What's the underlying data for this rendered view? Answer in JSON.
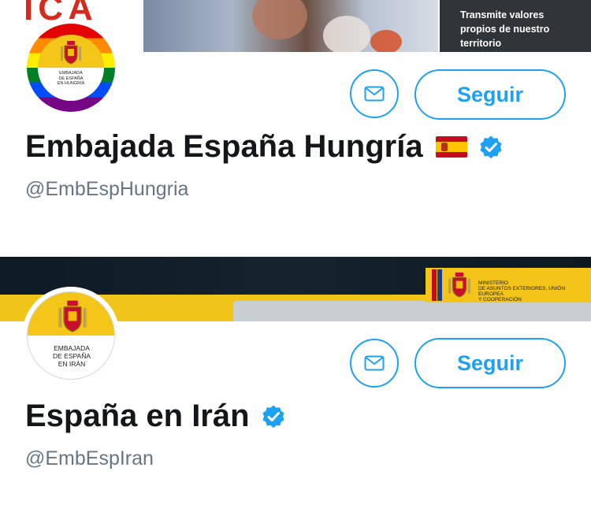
{
  "profiles": [
    {
      "banner": {
        "logo_text": "ICA",
        "text": "Transmite valores\npropios de nuestro\nterritorio"
      },
      "avatar": {
        "text": "EMBAJADA\nDE ESPAÑA\nEN HUNGRÍA",
        "style": "rainbow"
      },
      "message_icon": "envelope-icon",
      "follow_label": "Seguir",
      "name": "Embajada España Hungría",
      "flag_icon": "spain-flag-icon",
      "verified_icon": "verified-badge-icon",
      "handle": "@EmbEspHungria"
    },
    {
      "banner": {
        "ministry_text": "MINISTERIO\nDE ASUNTOS EXTERIORES, UNIÓN EUROPEA\nY COOPERACIÓN"
      },
      "avatar": {
        "text": "EMBAJADA\nDE ESPAÑA\nEN IRÁN",
        "style": "yellow-white"
      },
      "message_icon": "envelope-icon",
      "follow_label": "Seguir",
      "name": "España en Irán",
      "verified_icon": "verified-badge-icon",
      "handle": "@EmbEspIran"
    }
  ],
  "colors": {
    "accent": "#1DA1F2",
    "name": "#14171A",
    "handle": "#657786"
  }
}
